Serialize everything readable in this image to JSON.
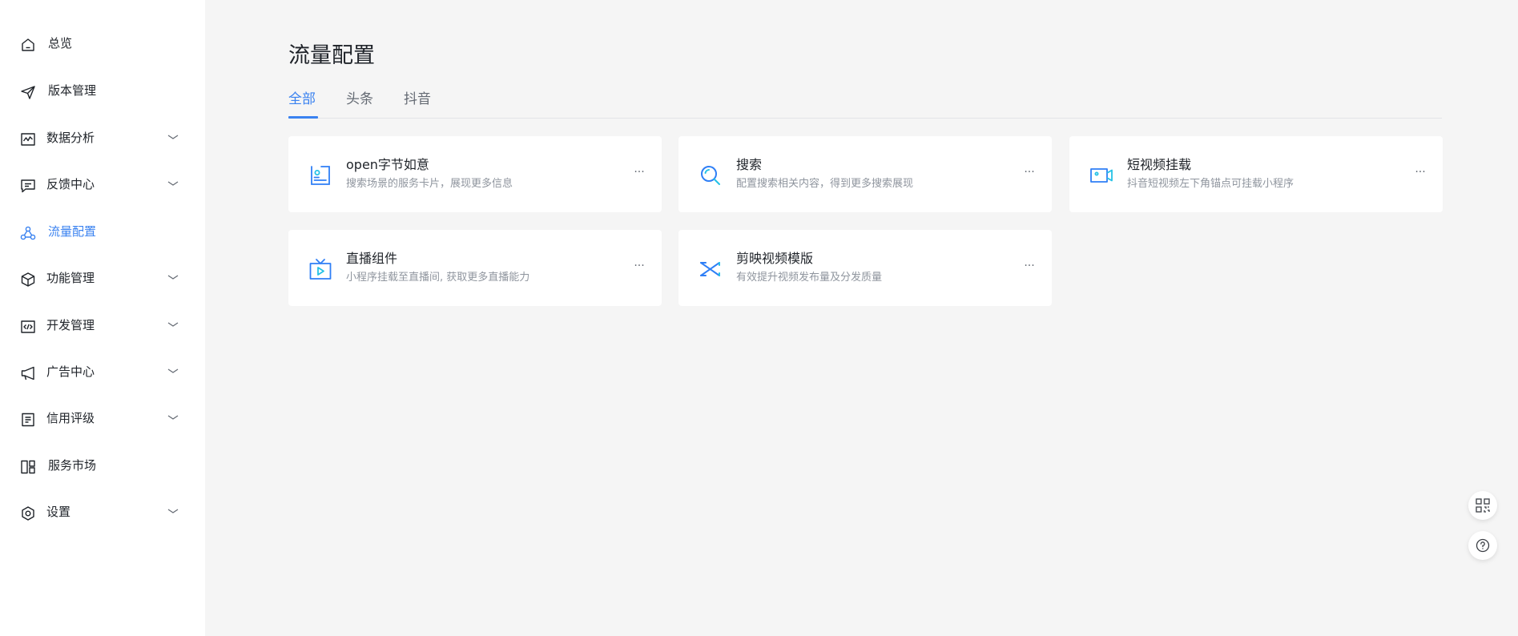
{
  "sidebar": {
    "items": [
      {
        "label": "总览",
        "icon": "home-icon",
        "expandable": false,
        "active": false
      },
      {
        "label": "版本管理",
        "icon": "send-icon",
        "expandable": false,
        "active": false
      },
      {
        "label": "数据分析",
        "icon": "chart-icon",
        "expandable": true,
        "active": false
      },
      {
        "label": "反馈中心",
        "icon": "message-icon",
        "expandable": true,
        "active": false
      },
      {
        "label": "流量配置",
        "icon": "nodes-icon",
        "expandable": false,
        "active": true
      },
      {
        "label": "功能管理",
        "icon": "cube-icon",
        "expandable": true,
        "active": false
      },
      {
        "label": "开发管理",
        "icon": "code-icon",
        "expandable": true,
        "active": false
      },
      {
        "label": "广告中心",
        "icon": "megaphone-icon",
        "expandable": true,
        "active": false
      },
      {
        "label": "信用评级",
        "icon": "document-icon",
        "expandable": true,
        "active": false
      },
      {
        "label": "服务市场",
        "icon": "grid-icon",
        "expandable": false,
        "active": false
      },
      {
        "label": "设置",
        "icon": "settings-icon",
        "expandable": true,
        "active": false
      }
    ]
  },
  "main": {
    "title": "流量配置",
    "tabs": [
      {
        "label": "全部",
        "active": true
      },
      {
        "label": "头条",
        "active": false
      },
      {
        "label": "抖音",
        "active": false
      }
    ],
    "cards": [
      {
        "title": "open字节如意",
        "desc": "搜索场景的服务卡片，展现更多信息",
        "icon": "id-card-icon",
        "more": "···"
      },
      {
        "title": "搜索",
        "desc": "配置搜索相关内容，得到更多搜索展现",
        "icon": "search-icon",
        "more": "···"
      },
      {
        "title": "短视频挂载",
        "desc": "抖音短视频左下角锚点可挂载小程序",
        "icon": "video-camera-icon",
        "more": "···"
      },
      {
        "title": "直播组件",
        "desc": "小程序挂载至直播间, 获取更多直播能力",
        "icon": "live-tv-icon",
        "more": "···"
      },
      {
        "title": "剪映视频模版",
        "desc": "有效提升视频发布量及分发质量",
        "icon": "capcut-icon",
        "more": "···"
      }
    ]
  },
  "floating": [
    {
      "icon": "qrcode-icon"
    },
    {
      "icon": "help-icon"
    }
  ],
  "colors": {
    "accent": "#3a82f0",
    "icon_blue": "#2f7ff6",
    "icon_cyan": "#25c2e6",
    "background": "#f5f5f5",
    "text_primary": "#1f2329",
    "text_secondary": "#8f959e"
  }
}
